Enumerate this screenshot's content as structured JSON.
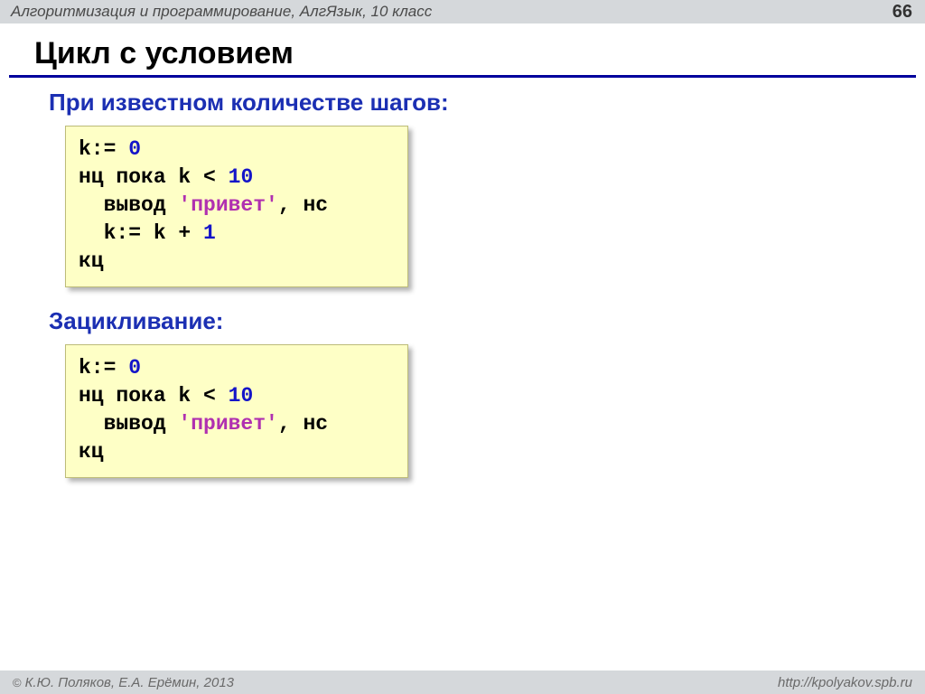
{
  "header": {
    "subject": "Алгоритмизация и программирование, АлгЯзык, 10 класс",
    "page": "66"
  },
  "title": "Цикл с условием",
  "section1": {
    "heading": "При известном количестве шагов:",
    "code": {
      "l1a": "k:= ",
      "l1n": "0",
      "l2a": "нц пока k < ",
      "l2n": "10",
      "l3a": "  вывод ",
      "l3s": "'привет'",
      "l3b": ", нс",
      "l4a": "  k:= k + ",
      "l4n": "1",
      "l5": "кц"
    }
  },
  "section2": {
    "heading": "Зацикливание:",
    "code": {
      "l1a": "k:= ",
      "l1n": "0",
      "l2a": "нц пока k < ",
      "l2n": "10",
      "l3a": "  вывод ",
      "l3s": "'привет'",
      "l3b": ", нс",
      "l4": "кц"
    }
  },
  "footer": {
    "copyright": "©",
    "authors": " К.Ю. Поляков, Е.А. Ерёмин, 2013",
    "url": "http://kpolyakov.spb.ru"
  }
}
